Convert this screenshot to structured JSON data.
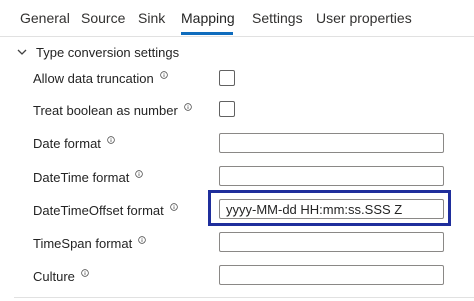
{
  "tabs": [
    {
      "label": "General"
    },
    {
      "label": "Source"
    },
    {
      "label": "Sink"
    },
    {
      "label": "Mapping",
      "active": true
    },
    {
      "label": "Settings"
    },
    {
      "label": "User properties"
    }
  ],
  "section": {
    "title": "Type conversion settings",
    "icon": "chevron-down-icon"
  },
  "fields": {
    "allow_truncation": {
      "label": "Allow data truncation",
      "checked": false
    },
    "treat_boolean": {
      "label": "Treat boolean as number",
      "checked": false
    },
    "date_format": {
      "label": "Date format",
      "value": ""
    },
    "datetime_format": {
      "label": "DateTime format",
      "value": ""
    },
    "datetimeoffset_format": {
      "label": "DateTimeOffset format",
      "value": "yyyy-MM-dd HH:mm:ss.SSS Z"
    },
    "timespan_format": {
      "label": "TimeSpan format",
      "value": ""
    },
    "culture": {
      "label": "Culture",
      "value": ""
    }
  },
  "colors": {
    "accent": "#0f6cbd",
    "highlight_box": "#1f2e9c"
  }
}
